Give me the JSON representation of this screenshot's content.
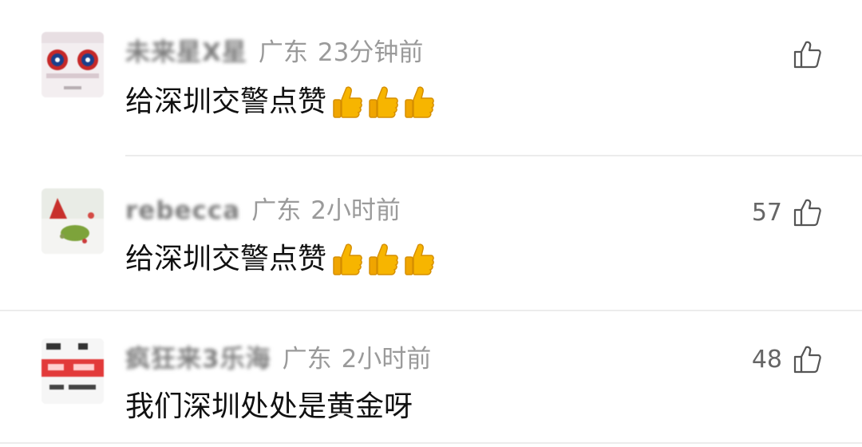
{
  "comments": [
    {
      "username": "未来星X星",
      "region": "广东",
      "time": "23分钟前",
      "text": "给深圳交警点赞",
      "emoji": [
        "thumbs-up",
        "thumbs-up",
        "thumbs-up"
      ],
      "likes": ""
    },
    {
      "username": "rebecca",
      "region": "广东",
      "time": "2小时前",
      "text": "给深圳交警点赞",
      "emoji": [
        "thumbs-up",
        "thumbs-up",
        "thumbs-up"
      ],
      "likes": "57"
    },
    {
      "username": "疯狂来3乐海",
      "region": "广东",
      "time": "2小时前",
      "text": "我们深圳处处是黄金呀",
      "emoji": [],
      "likes": "48"
    }
  ],
  "icons": {
    "like": "thumbs-up-outline-icon",
    "emoji": "thumbs-up-emoji"
  },
  "colors": {
    "meta": "#9a9a9a",
    "text": "#111111",
    "divider": "#ececec",
    "emoji": "#f7b500"
  }
}
